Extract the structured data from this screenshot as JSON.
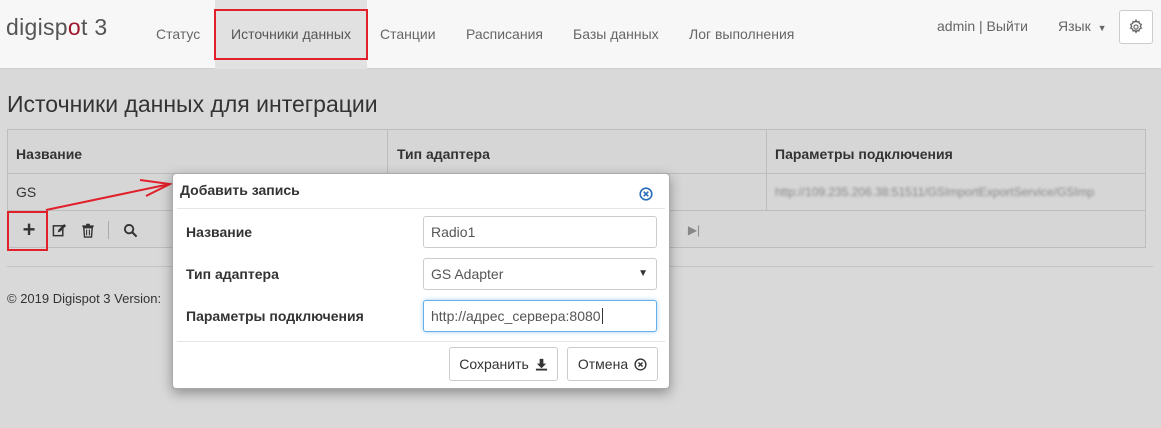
{
  "brand": {
    "text_before": "digisp",
    "dot": "o",
    "text_after": "t 3",
    "accent_color": "#a0182b"
  },
  "nav": {
    "items": [
      "Статус",
      "Источники данных",
      "Станции",
      "Расписания",
      "Базы данных",
      "Лог выполнения"
    ],
    "user": "admin | Выйти",
    "language": "Язык",
    "settings_icon": "gear-icon"
  },
  "page": {
    "title": "Источники данных для интеграции"
  },
  "grid": {
    "columns": [
      "Название",
      "Тип адаптера",
      "Параметры подключения"
    ],
    "rows": [
      {
        "name": "GS",
        "adapter": "",
        "connection": "http://109.235.206.38:51511/GSImportExportService/GSImp"
      }
    ]
  },
  "toolbar": {
    "add_icon": "plus-icon",
    "edit_icon": "edit-icon",
    "delete_icon": "trash-icon",
    "search_icon": "search-icon",
    "last_page_icon": "last-page-icon"
  },
  "footer": {
    "text": "© 2019 Digispot 3 Version:"
  },
  "dialog": {
    "title": "Добавить запись",
    "fields": [
      {
        "label": "Название",
        "value": "Radio1"
      },
      {
        "label": "Тип адаптера",
        "value": "GS Adapter"
      },
      {
        "label": "Параметры подключения",
        "value": "http://адрес_сервера:8080"
      }
    ],
    "save_label": "Сохранить",
    "cancel_label": "Отмена"
  },
  "annotation_color": "#e0202b"
}
